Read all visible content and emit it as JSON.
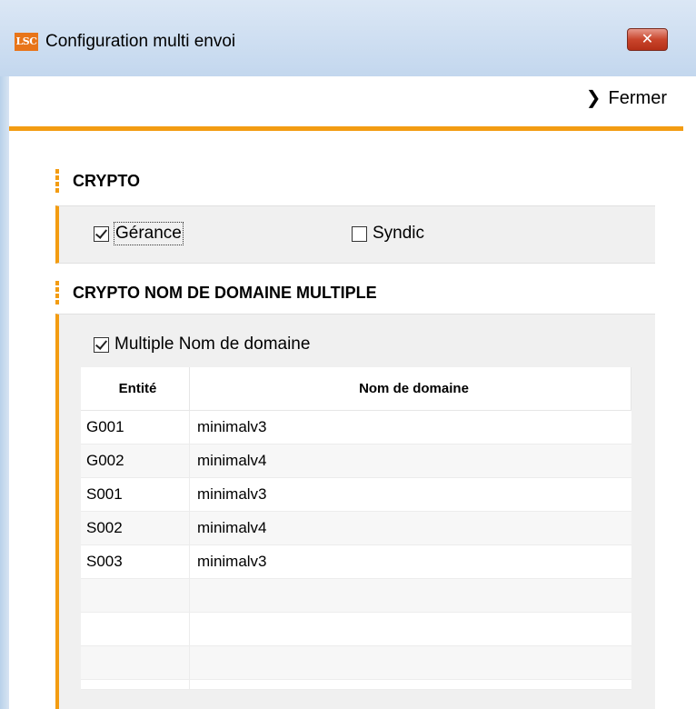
{
  "window": {
    "logo_text": "LSC",
    "title": "Configuration multi envoi",
    "close_glyph": "✕"
  },
  "toolbar": {
    "close_label": "Fermer",
    "close_icon": "chevron-right-icon"
  },
  "accent_color": "#f39c12",
  "crypto": {
    "title": "CRYPTO",
    "gerance": {
      "label": "Gérance",
      "checked": true
    },
    "syndic": {
      "label": "Syndic",
      "checked": false
    }
  },
  "domain": {
    "title": "CRYPTO NOM DE DOMAINE MULTIPLE",
    "multiple": {
      "label": "Multiple Nom de domaine",
      "checked": true
    },
    "table": {
      "headers": [
        "Entité",
        "Nom de domaine"
      ],
      "rows": [
        [
          "G001",
          "minimalv3"
        ],
        [
          "G002",
          "minimalv4"
        ],
        [
          "S001",
          "minimalv3"
        ],
        [
          "S002",
          "minimalv4"
        ],
        [
          "S003",
          "minimalv3"
        ],
        [
          "",
          ""
        ],
        [
          "",
          ""
        ],
        [
          "",
          ""
        ],
        [
          "",
          ""
        ]
      ]
    }
  }
}
